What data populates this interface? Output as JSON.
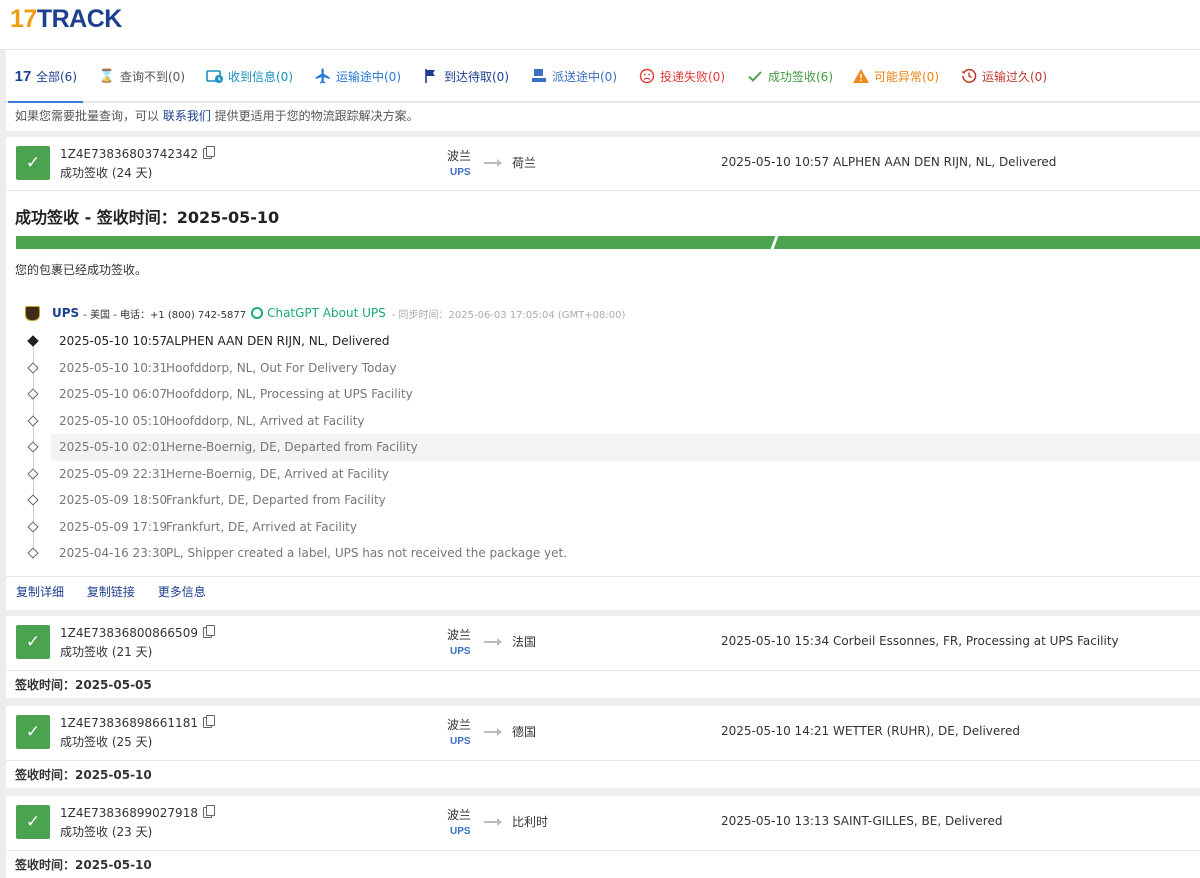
{
  "logo": {
    "part1": "17",
    "part2": "TRACK"
  },
  "tabs": [
    {
      "label": "全部(6)",
      "color": "#1d3f8f",
      "icon": "17-logo-icon"
    },
    {
      "label": "查询不到(0)",
      "color": "#555555",
      "icon": "hourglass-icon"
    },
    {
      "label": "收到信息(0)",
      "color": "#1a8fbf",
      "icon": "info-received-icon"
    },
    {
      "label": "运输途中(0)",
      "color": "#2a78d4",
      "icon": "airplane-icon"
    },
    {
      "label": "到达待取(0)",
      "color": "#1d3f8f",
      "icon": "flag-icon"
    },
    {
      "label": "派送途中(0)",
      "color": "#3a6fc1",
      "icon": "delivery-icon"
    },
    {
      "label": "投递失败(0)",
      "color": "#e03a3a",
      "icon": "sad-face-icon"
    },
    {
      "label": "成功签收(6)",
      "color": "#3f9a41",
      "icon": "check-icon"
    },
    {
      "label": "可能异常(0)",
      "color": "#e8850d",
      "icon": "warning-icon"
    },
    {
      "label": "运输过久(0)",
      "color": "#c0392b",
      "icon": "clock-history-icon"
    }
  ],
  "notice": {
    "before": "如果您需要批量查询，可以 ",
    "link": "联系我们",
    "after": " 提供更适用于您的物流跟踪解决方案。"
  },
  "cards": [
    {
      "tracking": "1Z4E73836803742342",
      "status": "成功签收 (24 天)",
      "from": "波兰",
      "carrier": "UPS",
      "to": "荷兰",
      "last_event": "2025-05-10 10:57  ALPHEN AAN DEN RIJN, NL, Delivered"
    },
    {
      "tracking": "1Z4E73836800866509",
      "status": "成功签收 (21 天)",
      "from": "波兰",
      "carrier": "UPS",
      "to": "法国",
      "last_event": "2025-05-10 15:34  Corbeil Essonnes, FR, Processing at UPS Facility",
      "signed": "签收时间：2025-05-05"
    },
    {
      "tracking": "1Z4E73836898661181",
      "status": "成功签收 (25 天)",
      "from": "波兰",
      "carrier": "UPS",
      "to": "德国",
      "last_event": "2025-05-10 14:21  WETTER (RUHR), DE, Delivered",
      "signed": "签收时间：2025-05-10"
    },
    {
      "tracking": "1Z4E73836899027918",
      "status": "成功签收 (23 天)",
      "from": "波兰",
      "carrier": "UPS",
      "to": "比利时",
      "last_event": "2025-05-10 13:13  SAINT-GILLES, BE, Delivered",
      "signed": "签收时间：2025-05-10"
    }
  ],
  "detail": {
    "title": "成功签收 - 签收时间：2025-05-10",
    "message": "您的包裹已经成功签收。",
    "carrier_name": "UPS",
    "carrier_meta": " - 美国 - 电话：+1 (800) 742-5877",
    "chatgpt_label": "ChatGPT About UPS",
    "sync": "- 同步时间：2025-06-03 17:05:04 (GMT+08:00)",
    "events": [
      {
        "time": "2025-05-10 10:57",
        "desc": "ALPHEN AAN DEN RIJN, NL, Delivered"
      },
      {
        "time": "2025-05-10 10:31",
        "desc": "Hoofddorp, NL, Out For Delivery Today"
      },
      {
        "time": "2025-05-10 06:07",
        "desc": "Hoofddorp, NL, Processing at UPS Facility"
      },
      {
        "time": "2025-05-10 05:10",
        "desc": "Hoofddorp, NL, Arrived at Facility"
      },
      {
        "time": "2025-05-10 02:01",
        "desc": "Herne-Boernig, DE, Departed from Facility"
      },
      {
        "time": "2025-05-09 22:31",
        "desc": "Herne-Boernig, DE, Arrived at Facility"
      },
      {
        "time": "2025-05-09 18:50",
        "desc": "Frankfurt, DE, Departed from Facility"
      },
      {
        "time": "2025-05-09 17:19",
        "desc": "Frankfurt, DE, Arrived at Facility"
      },
      {
        "time": "2025-04-16 23:30",
        "desc": "PL, Shipper created a label, UPS has not received the package yet."
      }
    ],
    "links": [
      "复制详细",
      "复制链接",
      "更多信息"
    ]
  }
}
